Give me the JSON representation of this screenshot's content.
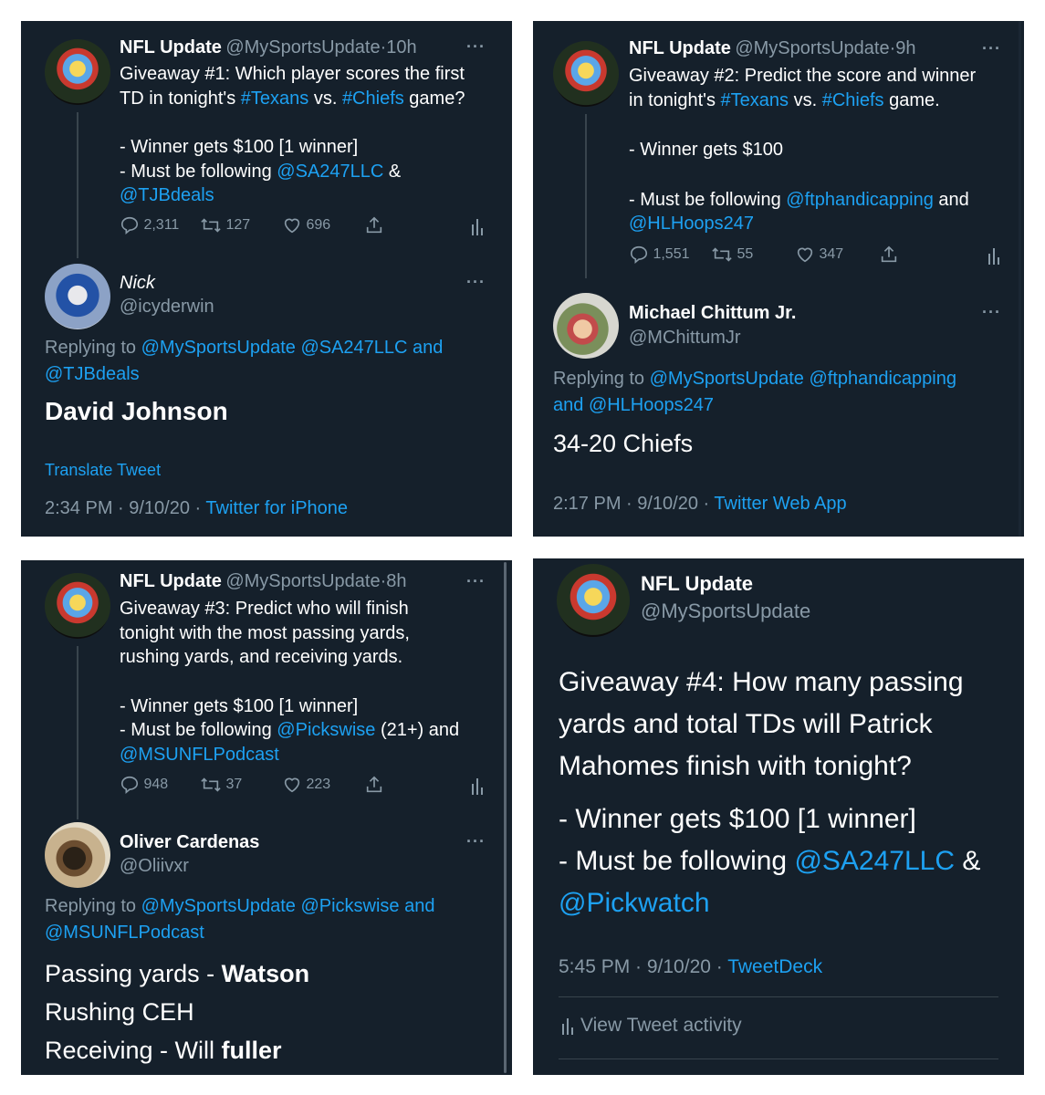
{
  "p1": {
    "tweet": {
      "name": "NFL Update",
      "handle": "@MySportsUpdate",
      "dot": "·",
      "time": "10h",
      "line1": "Giveaway #1: Which player scores the first",
      "line2_a": "TD in tonight's ",
      "line2_tag1": "#Texans",
      "line2_vs": " vs. ",
      "line2_tag2": "#Chiefs",
      "line2_end": " game?",
      "line3": "- Winner gets $100 [1 winner]",
      "line4_a": "- Must be following ",
      "line4_link": "@SA247LLC",
      "line4_end": " &",
      "line5_link": "@TJBdeals",
      "replies": "2,311",
      "retweets": "127",
      "likes": "696"
    },
    "reply": {
      "name": "Nick",
      "handle": "@icyderwin",
      "replying_to": "Replying to ",
      "mention1": "@MySportsUpdate",
      "mention2": " @SA247LLC",
      "and": " and",
      "mention3": "@TJBdeals",
      "text": "David Johnson",
      "translate": "Translate Tweet",
      "timestamp": "2:34 PM · 9/10/20 · ",
      "source": "Twitter for iPhone"
    }
  },
  "p2": {
    "tweet": {
      "name": "NFL Update",
      "handle": "@MySportsUpdate",
      "dot": "·",
      "time": "9h",
      "line1": "Giveaway #2: Predict the score and winner",
      "line2_a": "in tonight's ",
      "line2_tag1": "#Texans",
      "line2_vs": " vs. ",
      "line2_tag2": "#Chiefs",
      "line2_end": " game.",
      "line3": "- Winner gets $100",
      "line4_a": "- Must be following ",
      "line4_link": "@ftphandicapping",
      "line4_end": " and",
      "line5_link": "@HLHoops247",
      "replies": "1,551",
      "retweets": "55",
      "likes": "347"
    },
    "reply": {
      "name": "Michael Chittum Jr.",
      "handle": "@MChittumJr",
      "replying_to": "Replying to ",
      "mention1": "@MySportsUpdate",
      "mention2": " @ftphandicapping",
      "and": "and ",
      "mention3": "@HLHoops247",
      "text": "34-20 Chiefs",
      "timestamp": "2:17 PM · 9/10/20 · ",
      "source": "Twitter Web App"
    }
  },
  "p3": {
    "tweet": {
      "name": "NFL Update",
      "handle": "@MySportsUpdate",
      "dot": "·",
      "time": "8h",
      "line1": "Giveaway #3: Predict who will finish",
      "line2": "tonight with the most passing yards,",
      "line3": "rushing yards, and receiving yards.",
      "line4": "- Winner gets $100 [1 winner]",
      "line5_a": "- Must be following ",
      "line5_link": "@Pickswise",
      "line5_end": " (21+) and",
      "line6_link": "@MSUNFLPodcast",
      "replies": "948",
      "retweets": "37",
      "likes": "223"
    },
    "reply": {
      "name": "Oliver Cardenas",
      "handle": "@Oliivxr",
      "replying_to": "Replying to ",
      "mention1": "@MySportsUpdate",
      "mention2": " @Pickswise",
      "and": " and",
      "mention3": "@MSUNFLPodcast",
      "l1_a": "Passing yards - ",
      "l1_b": "Watson",
      "l2": "Rushing CEH",
      "l3_a": "Receiving - Will ",
      "l3_b": "fuller"
    }
  },
  "p4": {
    "name": "NFL Update",
    "handle": "@MySportsUpdate",
    "line1": "Giveaway #4: How many passing",
    "line2": "yards and total TDs will Patrick",
    "line3": "Mahomes finish with tonight?",
    "line4": "- Winner gets $100 [1 winner]",
    "line5_a": "- Must be following ",
    "line5_link": "@SA247LLC",
    "line5_end": " &",
    "line6_link": "@Pickwatch",
    "timestamp": "5:45 PM · 9/10/20 · ",
    "source": "TweetDeck",
    "activity": "View Tweet activity"
  },
  "colors": {
    "background": "#15202b",
    "link": "#1da1f2",
    "muted": "#8899a6"
  },
  "icons": [
    "reply-icon",
    "retweet-icon",
    "like-icon",
    "share-icon",
    "analytics-icon",
    "more-icon"
  ]
}
